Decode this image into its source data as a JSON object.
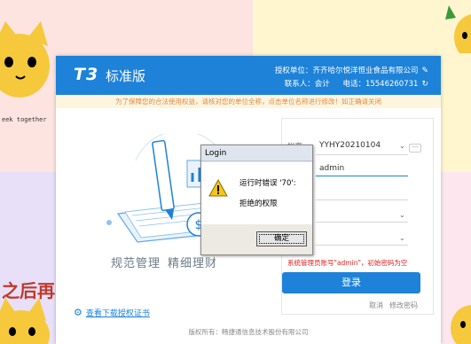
{
  "wallpaper": {
    "text_en": "eek together",
    "text_cn": "之后再"
  },
  "app": {
    "logo_mark": "T3",
    "product_name": "标准版",
    "auth_unit_label": "授权单位：",
    "auth_unit": "齐齐哈尔悦洋恒业食品有限公司",
    "contact_label": "联系人：",
    "contact": "会计",
    "phone_label": "电话：",
    "phone": "15546260731",
    "notice": "为了保障您的合法使用权益，请核对您的单位全称，点击单位名称进行修改！如正确请关闭",
    "slogan_1": "规范管理",
    "slogan_2": "精细理财",
    "cert_link": "查看下载授权证书",
    "footer": "版权所有：畅捷通信息技术股份有限公司"
  },
  "login_form": {
    "account_label": "帐套",
    "account_value": "YYHY20210104",
    "more_button": "···",
    "user_value": "admin",
    "warning": "系统管理员账号\"admin\"，初始密码为空",
    "login_button": "登录",
    "cancel_link": "取消",
    "change_password_link": "修改密码"
  },
  "dialog": {
    "title": "Login",
    "message_line1": "运行时错误 '70':",
    "message_line2": "拒绝的权限",
    "ok_button": "确定"
  },
  "colors": {
    "brand_blue": "#1d82d8",
    "warning_red": "#e02020",
    "notice_orange": "#e0894a"
  }
}
